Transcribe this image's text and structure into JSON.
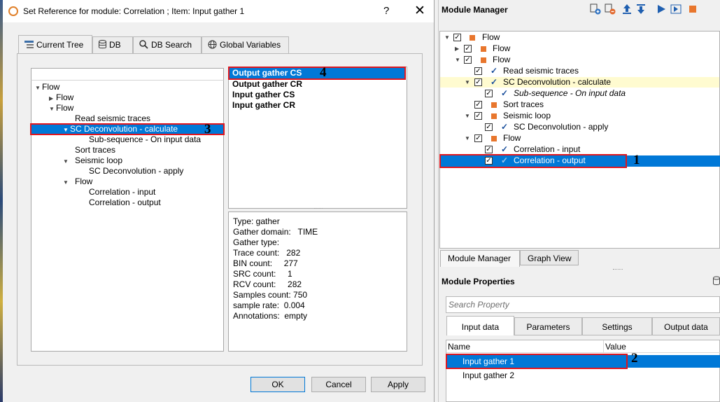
{
  "dialog": {
    "title": "Set Reference for module: Correlation ; Item: Input gather 1",
    "help_glyph": "?",
    "close_glyph": "✕",
    "tabs": [
      {
        "label": "Current Tree",
        "icon": "tree-icon"
      },
      {
        "label": "DB",
        "icon": "database-icon"
      },
      {
        "label": "DB Search",
        "icon": "search-icon"
      },
      {
        "label": "Global Variables",
        "icon": "globe-icon"
      }
    ],
    "tree": [
      {
        "label": "Flow",
        "arrow": "▼"
      },
      {
        "label": "Flow",
        "arrow": "▶"
      },
      {
        "label": "Flow",
        "arrow": "▼"
      },
      {
        "label": "Read seismic traces",
        "arrow": ""
      },
      {
        "label": "SC Deconvolution - calculate",
        "arrow": "▼"
      },
      {
        "label": "Sub-sequence - On input data",
        "arrow": ""
      },
      {
        "label": "Sort traces",
        "arrow": ""
      },
      {
        "label": "Seismic loop",
        "arrow": "▼"
      },
      {
        "label": "SC Deconvolution - apply",
        "arrow": ""
      },
      {
        "label": "Flow",
        "arrow": "▼"
      },
      {
        "label": "Correlation - input",
        "arrow": ""
      },
      {
        "label": "Correlation - output",
        "arrow": ""
      }
    ],
    "outputs": [
      "Output gather CS",
      "Output gather CR",
      "Input gather CS",
      "Input gather CR"
    ],
    "info": [
      "Type: gather",
      "Gather domain:   TIME",
      "Gather type:",
      "Trace count:   282",
      "BIN count:     277",
      "SRC count:     1",
      "RCV count:     282",
      "Samples count: 750",
      "sample rate:  0.004",
      "Annotations:  empty"
    ],
    "buttons": {
      "ok": "OK",
      "cancel": "Cancel",
      "apply": "Apply"
    }
  },
  "annotations": {
    "n1": "1",
    "n2": "2",
    "n3": "3",
    "n4": "4"
  },
  "module_manager": {
    "title": "Module Manager",
    "tree": [
      {
        "label": "Flow",
        "arrow": "▼",
        "mark": "sq",
        "italic": false
      },
      {
        "label": "Flow",
        "arrow": "▶",
        "mark": "sq",
        "italic": false
      },
      {
        "label": "Flow",
        "arrow": "▼",
        "mark": "sq",
        "italic": false
      },
      {
        "label": "Read seismic traces",
        "arrow": "",
        "mark": "tick",
        "italic": false
      },
      {
        "label": "SC Deconvolution - calculate",
        "arrow": "▼",
        "mark": "tick",
        "italic": false
      },
      {
        "label": "Sub-sequence - On input data",
        "arrow": "",
        "mark": "tick",
        "italic": true
      },
      {
        "label": "Sort traces",
        "arrow": "",
        "mark": "sq",
        "italic": false
      },
      {
        "label": "Seismic loop",
        "arrow": "▼",
        "mark": "sq",
        "italic": false
      },
      {
        "label": "SC Deconvolution - apply",
        "arrow": "",
        "mark": "tick",
        "italic": false
      },
      {
        "label": "Flow",
        "arrow": "▼",
        "mark": "sq",
        "italic": false
      },
      {
        "label": "Correlation - input",
        "arrow": "",
        "mark": "tick",
        "italic": false
      },
      {
        "label": "Correlation - output",
        "arrow": "",
        "mark": "tick",
        "italic": false
      }
    ],
    "bottom_tabs": [
      "Module Manager",
      "Graph View"
    ]
  },
  "module_properties": {
    "title": "Module Properties",
    "search_placeholder": "Search Property",
    "tabs": [
      "Input data",
      "Parameters",
      "Settings",
      "Output data"
    ],
    "col_name": "Name",
    "col_value": "Value",
    "rows": [
      "Input gather 1",
      "Input gather 2"
    ]
  },
  "colors": {
    "selection": "#0078d7",
    "highlight": "#fffbd0",
    "annotation_red": "#e0161e",
    "flow_orange": "#e8762d"
  }
}
